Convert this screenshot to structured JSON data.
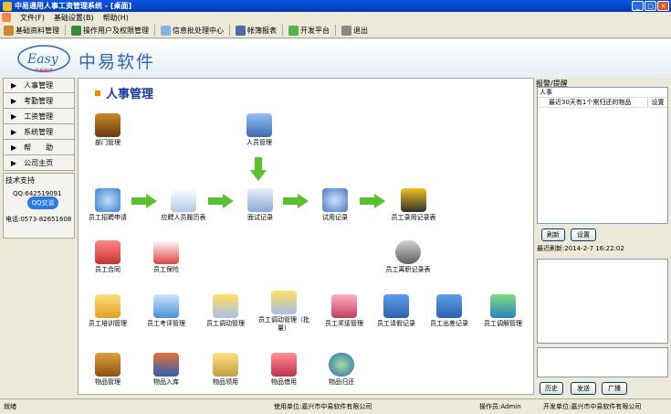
{
  "window": {
    "title": "中易通用人事工资管理系统 - [桌面]"
  },
  "menu": [
    "文件(F)",
    "基础设置(B)",
    "帮助(H)"
  ],
  "toolbar": [
    "基础资料管理",
    "操作用户及权限管理",
    "信息批处理中心",
    "帐簿报表",
    "开发平台",
    "退出"
  ],
  "header": {
    "logo_text": "Easy",
    "logo_sub": "中易软件",
    "brand": "中易软件"
  },
  "nav": [
    "人事管理",
    "考勤管理",
    "工资管理",
    "系统管理",
    "帮　　助",
    "公司主页"
  ],
  "support": {
    "label": "技术支持",
    "qq": "QQ:642519091",
    "qq_button": "QQ交谈",
    "phone": "电话:0573-82651608"
  },
  "page": {
    "title": "人事管理"
  },
  "modules": {
    "dept": "部门管理",
    "person": "人员管理",
    "recruit": "员工招聘申请",
    "resume": "应聘人员履历表",
    "interview": "面试记录",
    "trial": "试用记录",
    "hire": "员工录用记录表",
    "contract": "员工合同",
    "insurance": "员工保险",
    "leave": "员工离职记录表",
    "training": "员工培训管理",
    "assessment": "员工考评管理",
    "transfer": "员工调动管理",
    "transfer_batch": "员工调动管理（批量）",
    "reward": "员工奖惩管理",
    "absence": "员工请假记录",
    "trip": "员工出差记录",
    "dismiss": "员工调解管理",
    "goods": "物品管理",
    "goods_in": "物品入库",
    "goods_use": "物品领用",
    "goods_borrow": "物品借用",
    "goods_return": "物品归还"
  },
  "alarm": {
    "title": "报警/提醒",
    "category": "人事",
    "message": "最近30天有1个需归还的物品",
    "setting": "设置"
  },
  "buttons": {
    "refresh": "刷新",
    "settings": "设置",
    "history": "历史",
    "send": "发送",
    "broadcast": "广播"
  },
  "last_refresh": "最近刷新:2014-2-7  16:22:02",
  "status": {
    "ready": "就绪",
    "user_unit": "使用单位:嘉兴市中易软件有限公司",
    "operator": "操作员:Admin",
    "dev_unit": "开发单位:嘉兴市中易软件有限公司"
  }
}
